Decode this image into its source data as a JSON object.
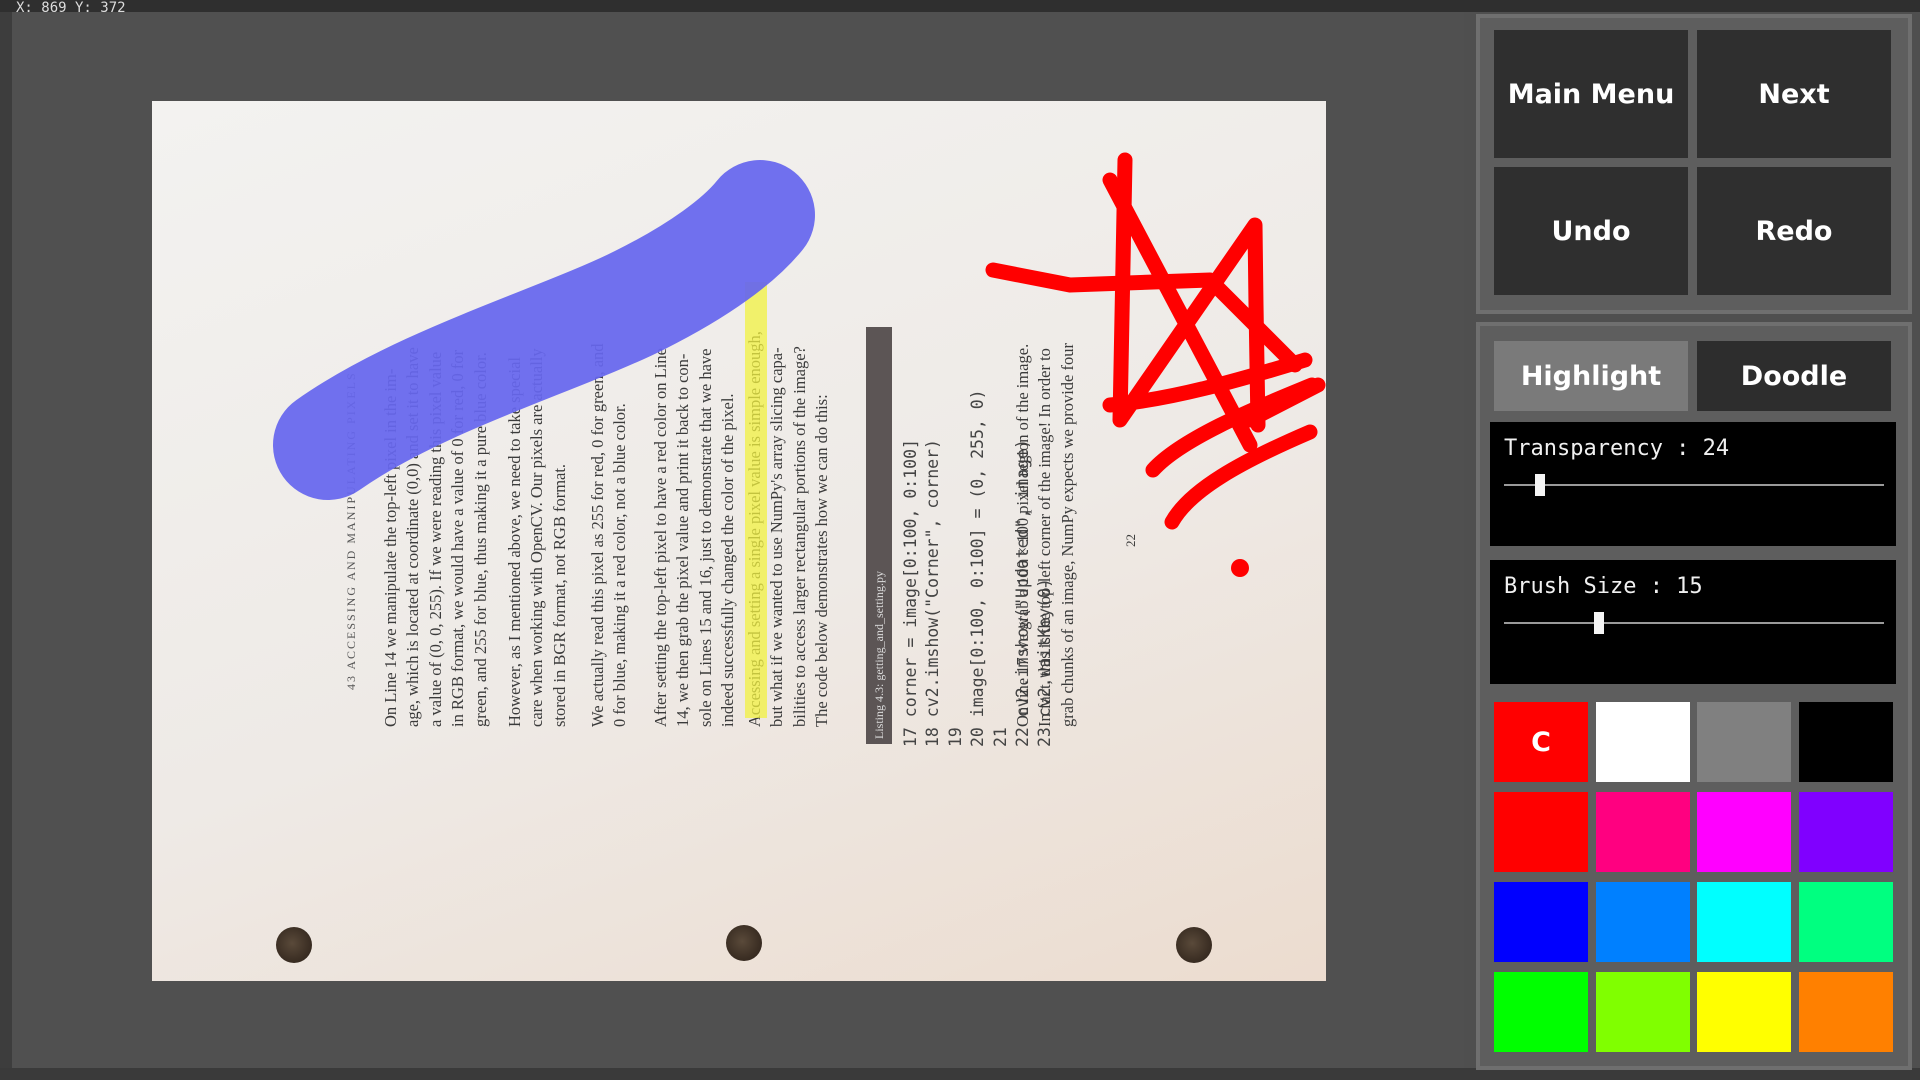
{
  "status": {
    "coords": "X: 869 Y: 372"
  },
  "document": {
    "running_head": "43 ACCESSING AND MANIPULATING PIXELS",
    "paragraphs": [
      {
        "lines": [
          "On Line 14 we manipulate the top-left pixel in the im-",
          "age, which is located at coordinate (0,0) and set it to have",
          "a value of (0, 0, 255). If we were reading this pixel value",
          "in RGB format, we would have a value of 0 for red, 0 for",
          "green, and 255 for blue, thus making it a pure blue color."
        ]
      },
      {
        "lines": [
          "However, as I mentioned above, we need to take special",
          "care when working with OpenCV. Our pixels are actually",
          "stored in BGR format, not RGB format."
        ]
      },
      {
        "lines": [
          "We actually read this pixel as 255 for red, 0 for green, and",
          "0 for blue, making it a red color, not a blue color."
        ]
      },
      {
        "lines": [
          "After setting the top-left pixel to have a red color on Line",
          "14, we then grab the pixel value and print it back to con-",
          "sole on Lines 15 and 16, just to demonstrate that we have",
          "indeed successfully changed the color of the pixel."
        ]
      },
      {
        "lines": [
          "Accessing and setting a single pixel value is simple enough,",
          "but what if we wanted to use NumPy's array slicing capa-",
          "bilities to access larger rectangular portions of the image?",
          "The code below demonstrates how we can do this:"
        ]
      }
    ],
    "listing_title": "Listing 4.3: getting_and_setting.py",
    "code_lines": [
      "17 corner = image[0:100, 0:100]",
      "18 cv2.imshow(\"Corner\", corner)",
      "19",
      "20 image[0:100, 0:100] = (0, 255, 0)",
      "21",
      "22 cv2.imshow(\"Updated\", image)",
      "23 cv2.waitKey(0)"
    ],
    "after_code": [
      "On line 17 we grab a 100 × 100 pixel region of the image.",
      "In fact, this is the top-left corner of the image! In order to",
      "grab chunks of an image, NumPy expects we provide four"
    ],
    "page_number": "22"
  },
  "nav": {
    "main_menu": "Main  Menu",
    "next": "Next",
    "undo": "Undo",
    "redo": "Redo"
  },
  "mode": {
    "highlight": "Highlight",
    "doodle": "Doodle",
    "active": "Highlight"
  },
  "sliders": {
    "transparency": {
      "label": "Transparency : 24",
      "value": 24,
      "max": 255
    },
    "brush": {
      "label": "Brush Size : 15",
      "value": 15,
      "max": 60
    }
  },
  "palette": {
    "clear_label": "C",
    "colors": [
      "#ff0000",
      "#ffffff",
      "#808080",
      "#000000",
      "#ff0000",
      "#ff0080",
      "#ff00ff",
      "#8000ff",
      "#0000ff",
      "#0080ff",
      "#00ffff",
      "#00ff80",
      "#00ff00",
      "#80ff00",
      "#ffff00",
      "#ff8000"
    ]
  },
  "annotations": {
    "highlight_color": "#6a6aee",
    "text_highlight_color": "#f0f040",
    "doodle_color": "#ff0000"
  }
}
